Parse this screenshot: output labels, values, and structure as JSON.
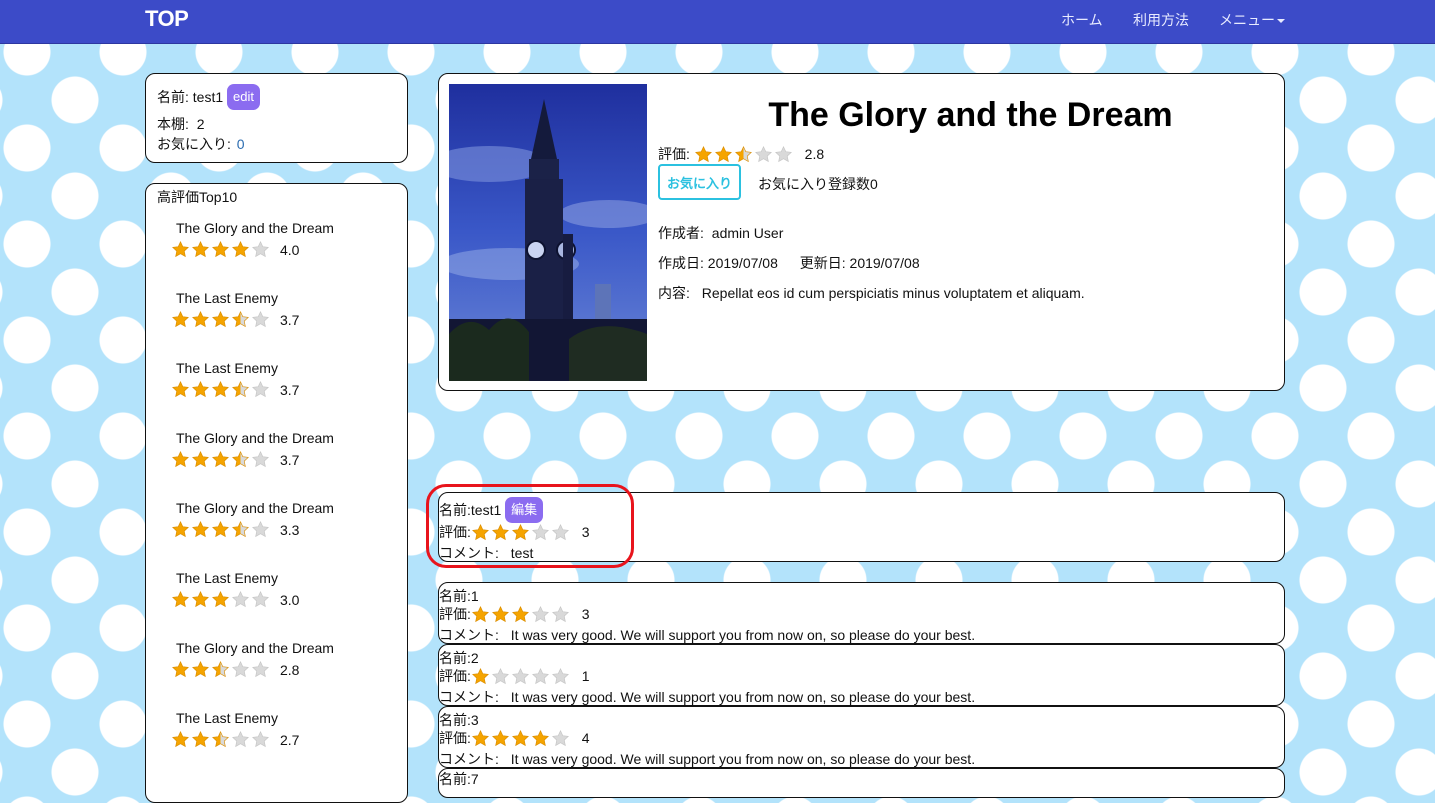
{
  "nav": {
    "brand": "TOP",
    "links": [
      "ホーム",
      "利用方法",
      "メニュー"
    ]
  },
  "profile": {
    "name_label": "名前: test1",
    "edit_label": "edit",
    "shelf_label": "本棚:",
    "shelf_value": "2",
    "fav_label": "お気に入り:",
    "fav_value": "0"
  },
  "ranking": {
    "title": "高評価Top10",
    "items": [
      {
        "title": "The Glory and the Dream",
        "rating": 4.0,
        "score": "4.0"
      },
      {
        "title": "The Last Enemy",
        "rating": 3.7,
        "score": "3.7"
      },
      {
        "title": "The Last Enemy",
        "rating": 3.7,
        "score": "3.7"
      },
      {
        "title": "The Glory and the Dream",
        "rating": 3.7,
        "score": "3.7"
      },
      {
        "title": "The Glory and the Dream",
        "rating": 3.3,
        "score": "3.3"
      },
      {
        "title": "The Last Enemy",
        "rating": 3.0,
        "score": "3.0"
      },
      {
        "title": "The Glory and the Dream",
        "rating": 2.8,
        "score": "2.8"
      },
      {
        "title": "The Last Enemy",
        "rating": 2.7,
        "score": "2.7"
      }
    ]
  },
  "book": {
    "title": "The Glory and the Dream",
    "rating_label": "評価:",
    "rating": 2.8,
    "rating_value": "2.8",
    "fav_button": "お気に入り",
    "fav_count_text": "お気に入り登録数0",
    "author_label": "作成者:",
    "author": "admin User",
    "created_label": "作成日:",
    "created": "2019/07/08",
    "updated_label": "更新日:",
    "updated": "2019/07/08",
    "content_label": "内容:",
    "content": "Repellat eos id cum perspiciatis minus voluptatem et aliquam."
  },
  "my_review": {
    "name_text": "名前:test1",
    "edit_label": "編集",
    "rating_label": "評価:",
    "rating": 3,
    "rating_value": "3",
    "comment_label": "コメント:",
    "comment": "test"
  },
  "reviews": [
    {
      "name_text": "名前:1",
      "rating_label": "評価:",
      "rating": 3,
      "rating_value": "3",
      "comment_label": "コメント:",
      "comment": "It was very good. We will support you from now on, so please do your best."
    },
    {
      "name_text": "名前:2",
      "rating_label": "評価:",
      "rating": 1,
      "rating_value": "1",
      "comment_label": "コメント:",
      "comment": "It was very good. We will support you from now on, so please do your best."
    },
    {
      "name_text": "名前:3",
      "rating_label": "評価:",
      "rating": 4,
      "rating_value": "4",
      "comment_label": "コメント:",
      "comment": "It was very good. We will support you from now on, so please do your best."
    },
    {
      "name_text": "名前:7"
    }
  ],
  "colors": {
    "navbar": "#3c4bc8",
    "background": "#b3e3fb",
    "star_filled": "#f5a400",
    "star_empty": "#d9d9d9",
    "edit_badge": "#8b6cf0",
    "fav_button": "#2bc1e0",
    "highlight": "#e8141c"
  }
}
